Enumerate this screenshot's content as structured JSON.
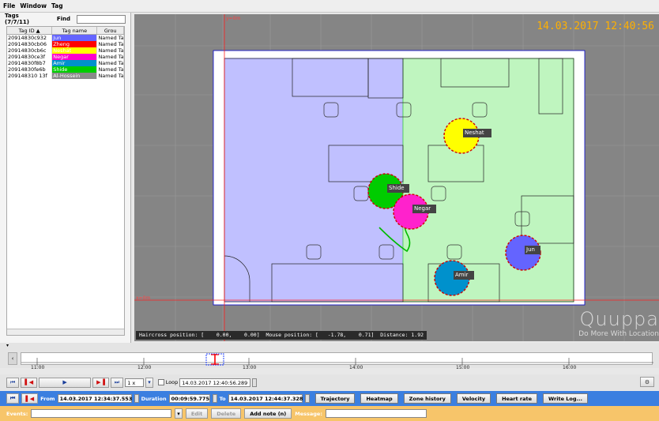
{
  "menu": {
    "items": [
      "File",
      "Window",
      "Tag"
    ]
  },
  "left_panel": {
    "tags_label": "Tags (7/7/11)",
    "find_label": "Find",
    "find_value": "",
    "columns": [
      "Tag ID ▲",
      "Tag name",
      "Grou"
    ],
    "rows": [
      {
        "id": "20914830c932",
        "name": "Jun",
        "group": "Named Ta",
        "color": "#6464ff"
      },
      {
        "id": "20914830cb06",
        "name": "Zheng",
        "group": "Named Ta",
        "color": "#ff0000"
      },
      {
        "id": "20914830cb6c",
        "name": "Neshat",
        "group": "Named Ta",
        "color": "#ffff00"
      },
      {
        "id": "20914830ce3f",
        "name": "Negar",
        "group": "Named Ta",
        "color": "#ff00cc"
      },
      {
        "id": "20914830f8b7",
        "name": "Amir",
        "group": "Named Ta",
        "color": "#0091cc"
      },
      {
        "id": "20914830fe6b",
        "name": "Shide",
        "group": "Named Ta",
        "color": "#00cc00"
      },
      {
        "id": "209148310 13f",
        "name": "Al-Hossein",
        "group": "Named Ta",
        "color": "#8a8a8a"
      }
    ]
  },
  "map": {
    "datetime": "14.03.2017 12:40:56",
    "axis_y_label": "y=0m",
    "axis_x_label": "x=0m",
    "status_text": "Haircross position: [    0.00,    0.00]  Mouse position: [   -1.78,    0.71]  Distance: 1.92",
    "logo_text": "Quuppa",
    "logo_tagline": "Do More With Location",
    "tags": [
      {
        "name": "Neshat",
        "color": "#ffff00"
      },
      {
        "name": "Shide",
        "color": "#00cc00"
      },
      {
        "name": "Negar",
        "color": "#ff22cc"
      },
      {
        "name": "Jun",
        "color": "#6464ff"
      },
      {
        "name": "Amir",
        "color": "#0091cc"
      }
    ]
  },
  "timeline": {
    "labels": [
      "11:00",
      "12:00",
      "13:00",
      "14:00",
      "15:00",
      "16:00"
    ]
  },
  "transport": {
    "speed": "1 x",
    "loop_label": "Loop",
    "loop_time": "14.03.2017 12:40:56.289"
  },
  "range_bar": {
    "from_label": "From",
    "from_value": "14.03.2017 12:34:37.553",
    "duration_label": "Duration",
    "duration_value": "00:09:59.775",
    "to_label": "To",
    "to_value": "14.03.2017 12:44:37.328",
    "buttons": [
      "Trajectory",
      "Heatmap",
      "Zone history",
      "Velocity",
      "Heart rate",
      "Write Log..."
    ]
  },
  "events_bar": {
    "events_label": "Events:",
    "edit_label": "Edit",
    "delete_label": "Delete",
    "add_note_label": "Add note (n)",
    "message_label": "Message:",
    "message_value": ""
  }
}
